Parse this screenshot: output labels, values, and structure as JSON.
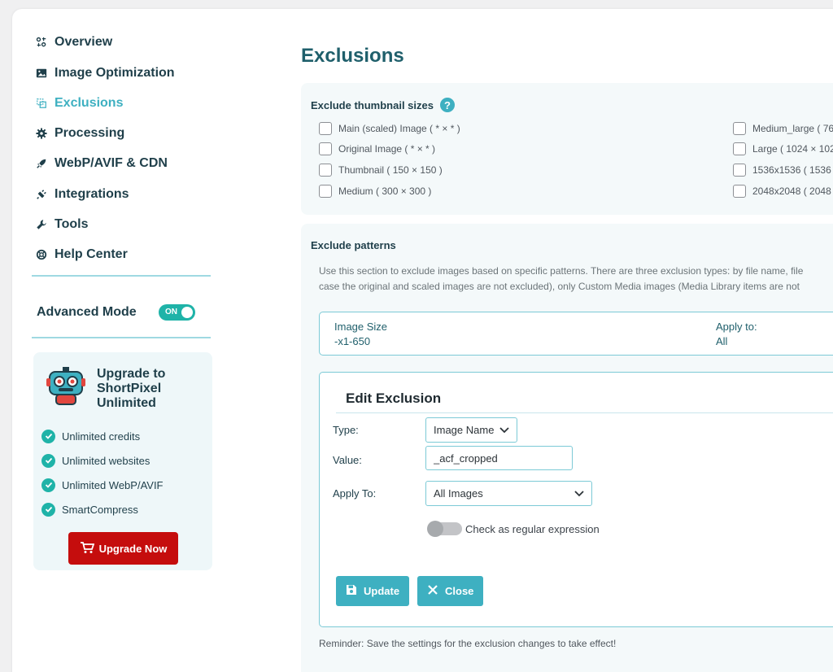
{
  "nav": {
    "items": [
      {
        "label": "Overview",
        "icon": "overview-icon"
      },
      {
        "label": "Image Optimization",
        "icon": "image-icon"
      },
      {
        "label": "Exclusions",
        "icon": "exclusions-icon",
        "active": true
      },
      {
        "label": "Processing",
        "icon": "gear-icon"
      },
      {
        "label": "WebP/AVIF & CDN",
        "icon": "rocket-icon"
      },
      {
        "label": "Integrations",
        "icon": "plug-icon"
      },
      {
        "label": "Tools",
        "icon": "wrench-icon"
      },
      {
        "label": "Help Center",
        "icon": "lifebuoy-icon"
      }
    ],
    "advanced_mode_label": "Advanced Mode",
    "advanced_mode_toggle": "ON"
  },
  "upgrade": {
    "title": "Upgrade to ShortPixel Unlimited",
    "features": [
      "Unlimited credits",
      "Unlimited websites",
      "Unlimited WebP/AVIF",
      "SmartCompress"
    ],
    "button_label": "Upgrade Now"
  },
  "page": {
    "title": "Exclusions"
  },
  "thumbs": {
    "heading": "Exclude thumbnail sizes",
    "help_glyph": "?",
    "left": [
      "Main (scaled) Image ( * × * )",
      "Original Image ( * × * )",
      "Thumbnail ( 150 × 150 )",
      "Medium ( 300 × 300 )"
    ],
    "right": [
      "Medium_large ( 76",
      "Large ( 1024 × 102",
      "1536x1536 ( 1536 ×",
      "2048x2048 ( 2048 ×"
    ]
  },
  "patterns": {
    "heading": "Exclude patterns",
    "desc_line1": "Use this section to exclude images based on specific patterns. There are three exclusion types: by file name, file",
    "desc_line2": "case the original and scaled images are not excluded), only Custom Media images (Media Library items are not",
    "row": {
      "type_label": "Image Size",
      "type_value": "-x1-650",
      "apply_label": "Apply to:",
      "apply_value": "All"
    },
    "edit": {
      "title": "Edit Exclusion",
      "type_label": "Type:",
      "type_value": "Image Name",
      "value_label": "Value:",
      "value_value": "_acf_cropped",
      "apply_label": "Apply To:",
      "apply_value": "All Images",
      "regex_label": "Check as regular expression",
      "update_label": "Update",
      "close_label": "Close"
    },
    "reminder": "Reminder: Save the settings for the exclusion changes to take effect!"
  },
  "colors": {
    "accent": "#3eb0c1",
    "dark": "#1f3f4a",
    "upgrade": "#c50d0d",
    "toggle": "#1fb3a8"
  }
}
